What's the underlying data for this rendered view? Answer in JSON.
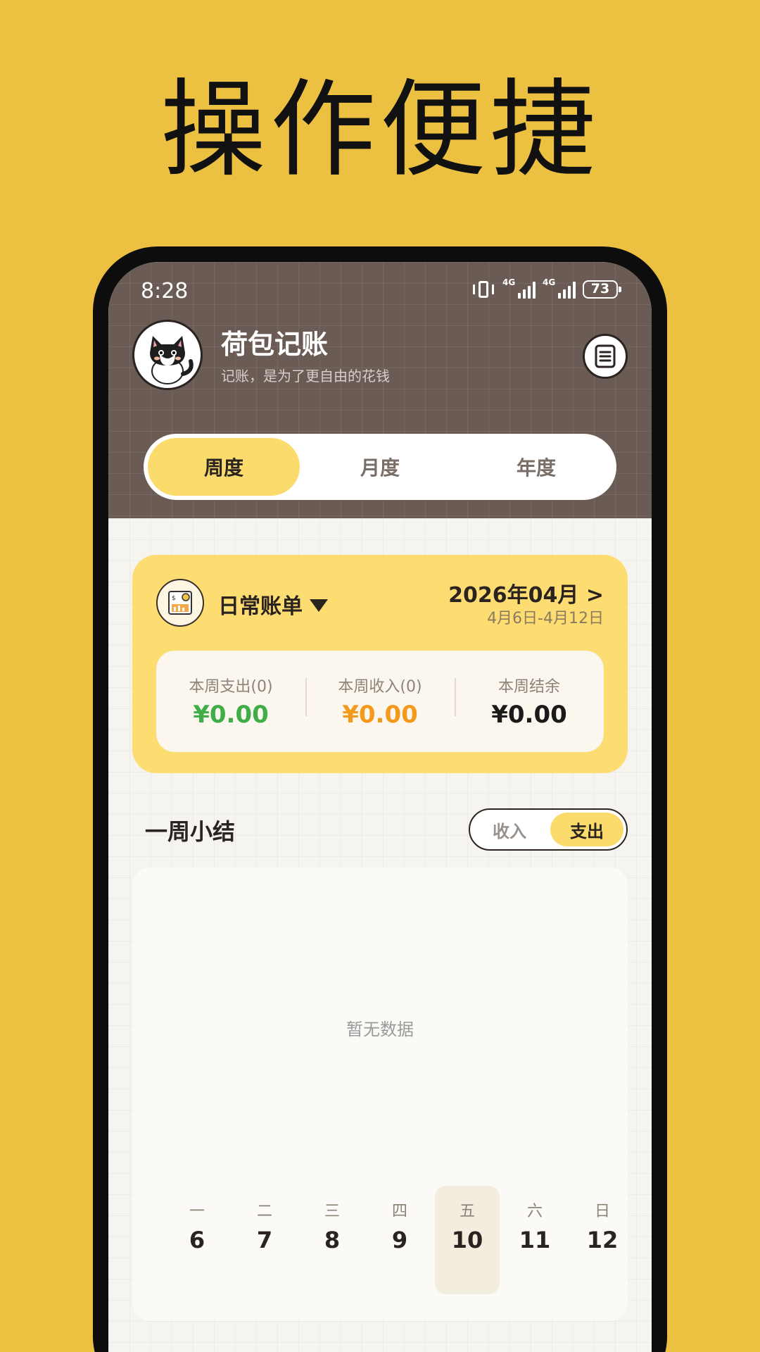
{
  "banner": {
    "title": "操作便捷"
  },
  "status_bar": {
    "time": "8:28",
    "network1": "4G",
    "network2": "4G",
    "battery": "73"
  },
  "header": {
    "app_title": "荷包记账",
    "app_subtitle": "记账，是为了更自由的花钱",
    "tabs": [
      {
        "label": "周度",
        "active": true
      },
      {
        "label": "月度",
        "active": false
      },
      {
        "label": "年度",
        "active": false
      }
    ]
  },
  "bill": {
    "name": "日常账单",
    "month": "2026年04月 >",
    "range": "4月6日-4月12日",
    "stats": [
      {
        "label": "本周支出(0)",
        "value": "¥0.00",
        "color": "#3FAE49"
      },
      {
        "label": "本周收入(0)",
        "value": "¥0.00",
        "color": "#F39A1C"
      },
      {
        "label": "本周结余",
        "value": "¥0.00",
        "color": "#1a1a1a"
      }
    ]
  },
  "summary": {
    "title": "一周小结",
    "toggle": [
      {
        "label": "收入",
        "active": false
      },
      {
        "label": "支出",
        "active": true
      }
    ],
    "empty_text": "暂无数据",
    "days": [
      {
        "weekday": "一",
        "date": "6"
      },
      {
        "weekday": "二",
        "date": "7"
      },
      {
        "weekday": "三",
        "date": "8"
      },
      {
        "weekday": "四",
        "date": "9"
      },
      {
        "weekday": "五",
        "date": "10",
        "active": true
      },
      {
        "weekday": "六",
        "date": "11"
      },
      {
        "weekday": "日",
        "date": "12"
      }
    ]
  },
  "colors": {
    "background": "#ECC142",
    "header": "#6A5B54",
    "accent": "#FADB6B",
    "card": "#FDDD72"
  }
}
